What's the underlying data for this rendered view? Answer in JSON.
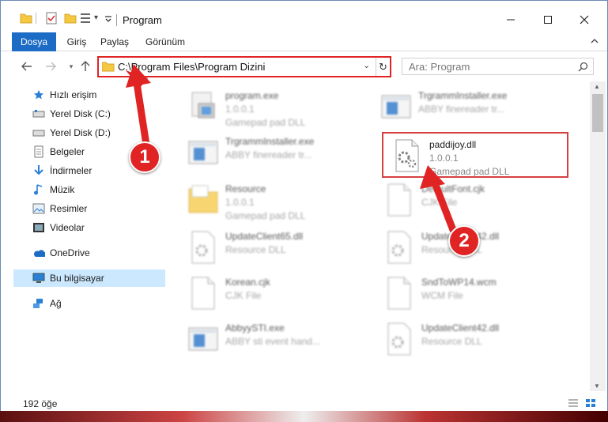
{
  "window": {
    "title": "Program"
  },
  "ribbon": {
    "tabs": [
      "Dosya",
      "Giriş",
      "Paylaş",
      "Görünüm"
    ]
  },
  "address": {
    "path": "C:\\Program Files\\Program Dizini",
    "search_placeholder": "Ara: Program"
  },
  "nav": {
    "quick_access": "Hızlı erişim",
    "items": [
      {
        "label": "Yerel Disk (C:)",
        "icon": "drive-icon"
      },
      {
        "label": "Yerel Disk (D:)",
        "icon": "drive-icon"
      },
      {
        "label": "Belgeler",
        "icon": "documents-icon"
      },
      {
        "label": "İndirmeler",
        "icon": "download-icon"
      },
      {
        "label": "Müzik",
        "icon": "music-icon"
      },
      {
        "label": "Resimler",
        "icon": "pictures-icon"
      },
      {
        "label": "Videolar",
        "icon": "videos-icon"
      }
    ],
    "onedrive": "OneDrive",
    "this_pc": "Bu bilgisayar",
    "network": "Ağ"
  },
  "files": [
    {
      "name": "program.exe",
      "l1": "1.0.0.1",
      "l2": "Gamepad pad DLL",
      "icon": "exe-icon"
    },
    {
      "name": "TrgrammInstaller.exe",
      "l1": "ABBY finereader tr...",
      "l2": "",
      "icon": "installer-icon"
    },
    {
      "name": "TrgrammInstaller.exe",
      "l1": "ABBY finereader tr...",
      "l2": "",
      "icon": "installer-icon"
    },
    {
      "name": "paddijoy.dll",
      "l1": "1.0.0.1",
      "l2": "Gamepad pad DLL",
      "icon": "dll-gear-icon"
    },
    {
      "name": "Resource",
      "l1": "1.0.0.1",
      "l2": "Gamepad pad DLL",
      "icon": "folder-icon"
    },
    {
      "name": "DefaultFont.cjk",
      "l1": "CJK File",
      "l2": "",
      "icon": "file-icon"
    },
    {
      "name": "UpdateClient65.dll",
      "l1": "Resource DLL",
      "l2": "",
      "icon": "dll-icon"
    },
    {
      "name": "UpdateClient42.dll",
      "l1": "Resource DLL",
      "l2": "",
      "icon": "dll-icon"
    },
    {
      "name": "Korean.cjk",
      "l1": "CJK File",
      "l2": "",
      "icon": "file-icon"
    },
    {
      "name": "SndToWP14.wcm",
      "l1": "WCM File",
      "l2": "",
      "icon": "file-icon"
    },
    {
      "name": "AbbyySTI.exe",
      "l1": "ABBY sti event hand...",
      "l2": "",
      "icon": "installer-icon"
    },
    {
      "name": "UpdateClient42.dll",
      "l1": "Resource DLL",
      "l2": "",
      "icon": "dll-icon"
    }
  ],
  "status": {
    "count": "192 öğe"
  },
  "callouts": [
    "1",
    "2"
  ],
  "colors": {
    "accent": "#1c6bc4",
    "highlight": "#e02424",
    "selected": "#cce8ff"
  }
}
